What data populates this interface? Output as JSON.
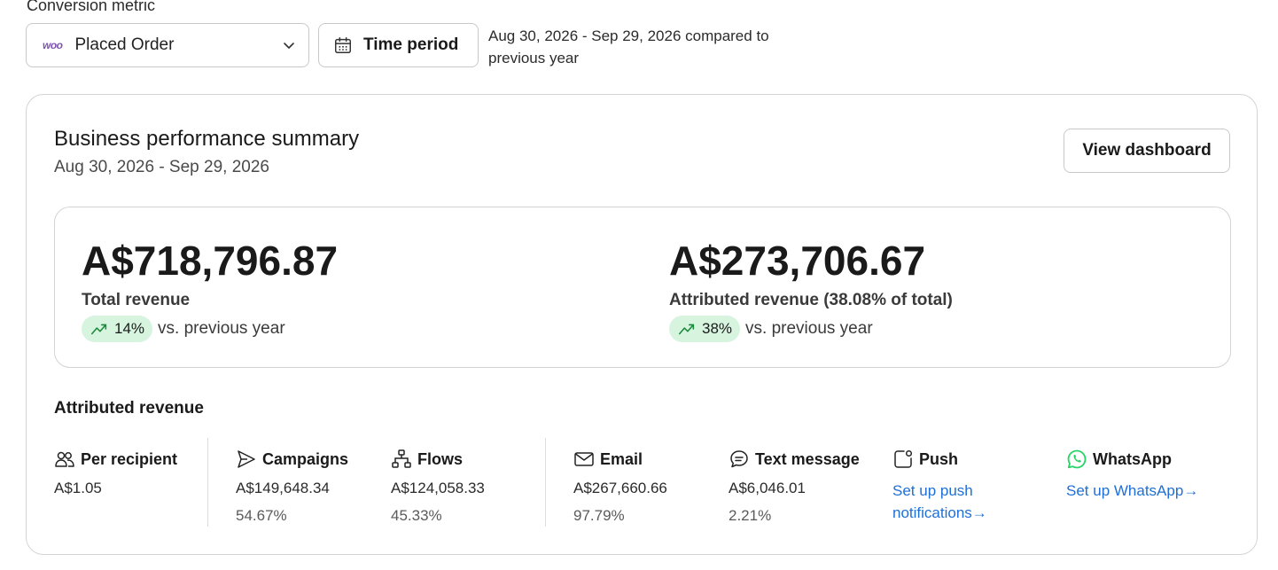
{
  "conversion": {
    "label": "Conversion metric",
    "selected": "Placed Order",
    "logo_text": "woo"
  },
  "time_period": {
    "button_label": "Time period",
    "description": "Aug 30, 2026 - Sep 29, 2026 compared to previous year"
  },
  "summary": {
    "title": "Business performance summary",
    "dates": "Aug 30, 2026 - Sep 29, 2026",
    "view_button": "View dashboard",
    "total": {
      "value": "A$718,796.87",
      "label": "Total revenue",
      "change": "14%",
      "change_suffix": "vs. previous year"
    },
    "attributed": {
      "value": "A$273,706.67",
      "label": "Attributed revenue (38.08% of total)",
      "change": "38%",
      "change_suffix": "vs. previous year"
    }
  },
  "attributed_section": {
    "title": "Attributed revenue",
    "columns": [
      {
        "label": "Per recipient",
        "icon": "users-icon",
        "value": "A$1.05"
      },
      {
        "label": "Campaigns",
        "icon": "send-icon",
        "value": "A$149,648.34",
        "percent": "54.67%"
      },
      {
        "label": "Flows",
        "icon": "flows-icon",
        "value": "A$124,058.33",
        "percent": "45.33%"
      },
      {
        "label": "Email",
        "icon": "email-icon",
        "value": "A$267,660.66",
        "percent": "97.79%"
      },
      {
        "label": "Text message",
        "icon": "chat-icon",
        "value": "A$6,046.01",
        "percent": "2.21%"
      },
      {
        "label": "Push",
        "icon": "push-icon",
        "link": "Set up push notifications"
      },
      {
        "label": "WhatsApp",
        "icon": "whatsapp-icon",
        "link": "Set up WhatsApp"
      }
    ]
  },
  "colors": {
    "accent_link": "#1f6fd6",
    "positive_pill": "#d7f4df",
    "positive_icon": "#1a8a3c",
    "woo_purple": "#7f54b3",
    "whatsapp_green": "#25d366"
  }
}
